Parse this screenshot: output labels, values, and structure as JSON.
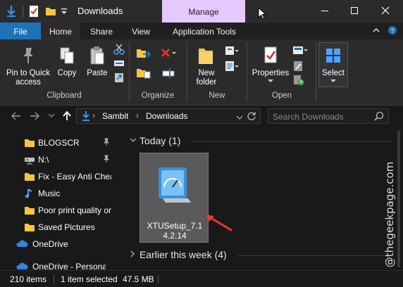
{
  "window": {
    "title": "Downloads",
    "context_tab": "Manage",
    "accent_color": "#1e73b8",
    "context_color": "#e4c9ff"
  },
  "ribbon_tabs": [
    "File",
    "Home",
    "Share",
    "View",
    "Application Tools"
  ],
  "ribbon": {
    "clipboard": {
      "pin_label": "Pin to Quick access",
      "copy_label": "Copy",
      "paste_label": "Paste",
      "group_label": "Clipboard"
    },
    "organize": {
      "group_label": "Organize"
    },
    "new": {
      "new_folder_label": "New folder",
      "group_label": "New"
    },
    "open": {
      "properties_label": "Properties",
      "group_label": "Open"
    },
    "select": {
      "select_label": "Select"
    }
  },
  "address": {
    "crumbs": [
      "Sambit",
      "Downloads"
    ],
    "search_placeholder": "Search Downloads"
  },
  "nav_items": [
    {
      "label": "BLOGSCR",
      "icon": "folder-icon"
    },
    {
      "label": "N:\\",
      "icon": "network-drive-icon"
    },
    {
      "label": "Fix - Easy Anti Chea",
      "icon": "folder-icon"
    },
    {
      "label": "Music",
      "icon": "music-icon"
    },
    {
      "label": "Poor print quality or",
      "icon": "folder-icon"
    },
    {
      "label": "Saved Pictures",
      "icon": "folder-icon"
    },
    {
      "label": "OneDrive",
      "icon": "cloud-icon"
    },
    {
      "label": "OneDrive - Personal",
      "icon": "cloud-icon"
    }
  ],
  "content": {
    "group_today": "Today (1)",
    "file_name": "XTUSetup_7.14.2.14",
    "group_earlier": "Earlier this week (4)"
  },
  "status": {
    "item_count": "210 items",
    "selection": "1 item selected",
    "size": "47.5 MB"
  },
  "watermark": "@thegeekpage.com"
}
